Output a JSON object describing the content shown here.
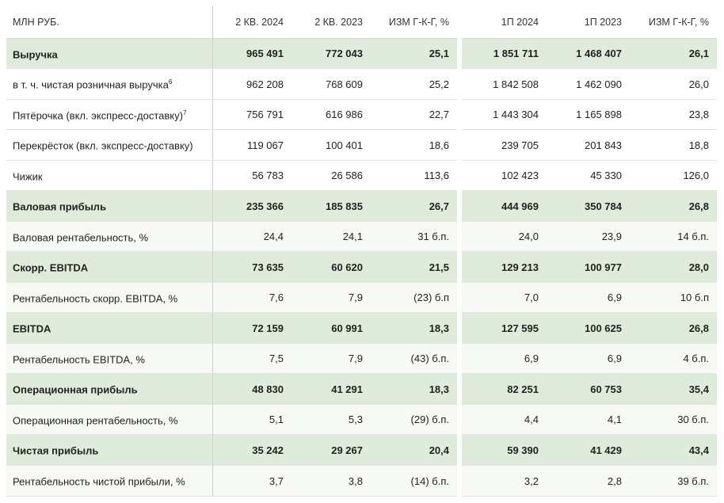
{
  "header": [
    "МЛН РУБ.",
    "2 КВ. 2024",
    "2 КВ. 2023",
    "ИЗМ Г-К-Г, %",
    "1П 2024",
    "1П 2023",
    "ИЗМ Г-К-Г, %"
  ],
  "rows": [
    {
      "style": "hl",
      "label": "Выручка",
      "sup": "",
      "v": [
        "965 491",
        "772 043",
        "25,1",
        "1 851 711",
        "1 468 407",
        "26,1"
      ]
    },
    {
      "style": "wh",
      "label": "в т. ч. чистая розничная выручка",
      "sup": "6",
      "v": [
        "962 208",
        "768 609",
        "25,2",
        "1 842 508",
        "1 462 090",
        "26,0"
      ]
    },
    {
      "style": "wh",
      "label": "Пятёрочка (вкл. экспресс-доставку)",
      "sup": "7",
      "v": [
        "756 791",
        "616 986",
        "22,7",
        "1 443 304",
        "1 165 898",
        "23,8"
      ]
    },
    {
      "style": "wh",
      "label": "Перекрёсток (вкл. экспресс-доставку)",
      "sup": "",
      "v": [
        "119 067",
        "100 401",
        "18,6",
        "239 705",
        "201 843",
        "18,8"
      ]
    },
    {
      "style": "wh",
      "label": "Чижик",
      "sup": "",
      "v": [
        "56 783",
        "26 586",
        "113,6",
        "102 423",
        "45 330",
        "126,0"
      ]
    },
    {
      "style": "hl",
      "label": "Валовая прибыль",
      "sup": "",
      "v": [
        "235 366",
        "185 835",
        "26,7",
        "444 969",
        "350 784",
        "26,8"
      ]
    },
    {
      "style": "pl",
      "label": "Валовая рентабельность, %",
      "sup": "",
      "v": [
        "24,4",
        "24,1",
        "31 б.п.",
        "24,0",
        "23,9",
        "14 б.п."
      ]
    },
    {
      "style": "hl",
      "label": "Скорр. EBITDA",
      "sup": "",
      "v": [
        "73 635",
        "60 620",
        "21,5",
        "129 213",
        "100 977",
        "28,0"
      ]
    },
    {
      "style": "pl",
      "label": "Рентабельность скорр. EBITDA, %",
      "sup": "",
      "v": [
        "7,6",
        "7,9",
        "(23) б.п",
        "7,0",
        "6,9",
        "10 б.п"
      ]
    },
    {
      "style": "hl",
      "label": "EBITDA",
      "sup": "",
      "v": [
        "72 159",
        "60 991",
        "18,3",
        "127 595",
        "100 625",
        "26,8"
      ]
    },
    {
      "style": "pl",
      "label": "Рентабельность EBITDA, %",
      "sup": "",
      "v": [
        "7,5",
        "7,9",
        "(43) б.п.",
        "6,9",
        "6,9",
        "4 б.п."
      ]
    },
    {
      "style": "hl",
      "label": "Операционная прибыль",
      "sup": "",
      "v": [
        "48 830",
        "41 291",
        "18,3",
        "82 251",
        "60 753",
        "35,4"
      ]
    },
    {
      "style": "pl",
      "label": "Операционная рентабельность, %",
      "sup": "",
      "v": [
        "5,1",
        "5,3",
        "(29) б.п.",
        "4,4",
        "4,1",
        "30 б.п."
      ]
    },
    {
      "style": "hl",
      "label": "Чистая прибыль",
      "sup": "",
      "v": [
        "35 242",
        "29 267",
        "20,4",
        "59 390",
        "41 429",
        "43,4"
      ]
    },
    {
      "style": "pl",
      "label": "Рентабельность чистой прибыли, %",
      "sup": "",
      "v": [
        "3,7",
        "3,8",
        "(14) б.п.",
        "3,2",
        "2,8",
        "39 б.п."
      ]
    }
  ]
}
